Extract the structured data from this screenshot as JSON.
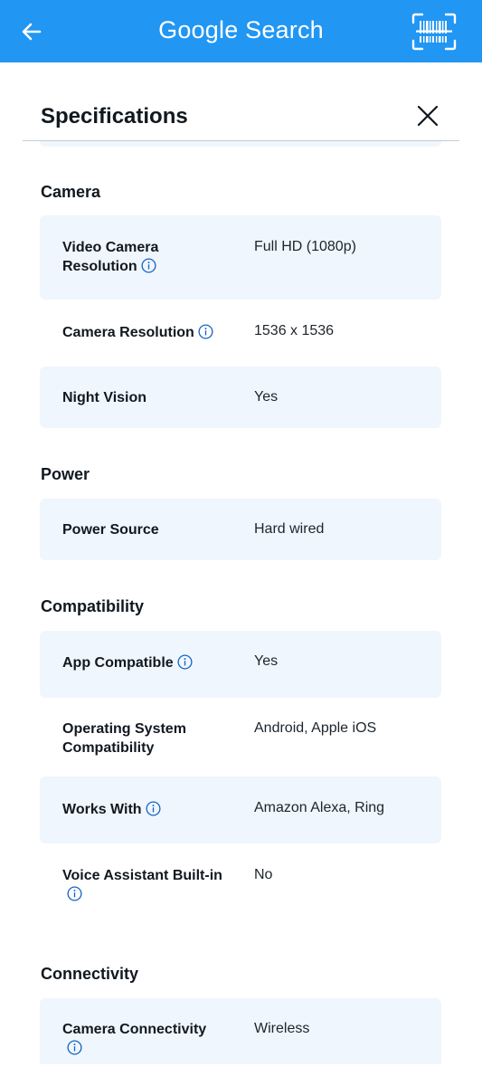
{
  "appbar": {
    "title": "Google Search",
    "back_icon": "arrow-left-icon",
    "scan_icon": "barcode-scan-icon",
    "color": "#2196f3"
  },
  "sheet": {
    "title": "Specifications",
    "close_icon": "close-icon"
  },
  "sections": {
    "camera": {
      "title": "Camera",
      "rows": [
        {
          "label_line1": "Video Camera",
          "label_line2": "Resolution",
          "value": "Full HD (1080p)",
          "info": true
        },
        {
          "label": "Camera Resolution",
          "value": "1536 x 1536",
          "info": true
        },
        {
          "label": "Night Vision",
          "value": "Yes",
          "info": false
        }
      ]
    },
    "power": {
      "title": "Power",
      "rows": [
        {
          "label": "Power Source",
          "value": "Hard wired",
          "info": false
        }
      ]
    },
    "compatibility": {
      "title": "Compatibility",
      "rows": [
        {
          "label": "App Compatible",
          "value": "Yes",
          "info": true
        },
        {
          "label_line1": "Operating System",
          "label_line2": "Compatibility",
          "value": "Android, Apple iOS",
          "info": false
        },
        {
          "label": "Works With",
          "value": "Amazon Alexa, Ring",
          "info": true
        },
        {
          "label": "Voice Assistant Built-in",
          "value": "No",
          "info": true
        }
      ]
    },
    "connectivity": {
      "title": "Connectivity",
      "rows": [
        {
          "label": "Camera Connectivity",
          "value": "Wireless",
          "info": true
        }
      ]
    }
  },
  "colors": {
    "row_shade": "#eff6fe",
    "info_icon": "#1565c0"
  }
}
